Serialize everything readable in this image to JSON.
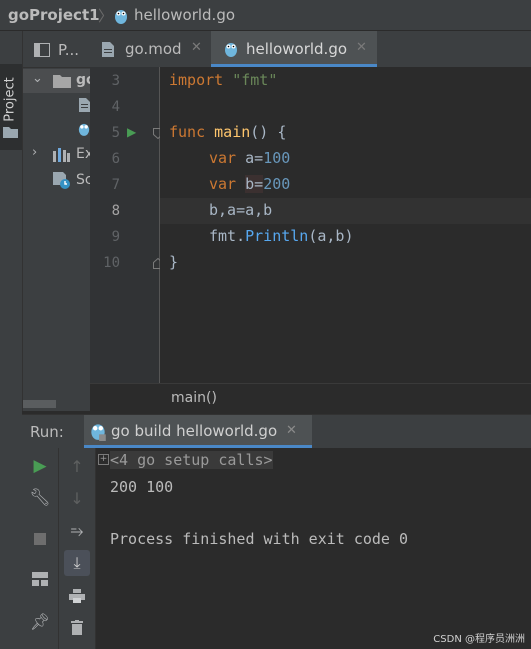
{
  "breadcrumb": {
    "project": "goProject1",
    "file": "helloworld.go"
  },
  "left_strip": {
    "project_tab": "Project"
  },
  "project_panel": {
    "header_label": "P...",
    "tree": [
      "go",
      "Ex",
      "Sc"
    ]
  },
  "tabs": [
    {
      "label": "go.mod",
      "active": false
    },
    {
      "label": "helloworld.go",
      "active": true
    }
  ],
  "editor": {
    "line_numbers": [
      "3",
      "4",
      "5",
      "6",
      "7",
      "8",
      "9",
      "10"
    ],
    "current_line": "8",
    "code": {
      "l3": {
        "kw": "import",
        "str": "\"fmt\""
      },
      "l5": {
        "kw": "func",
        "name": "main",
        "rest": "() {"
      },
      "l6": {
        "kw": "var",
        "var": "a=",
        "num": "100"
      },
      "l7": {
        "kw": "var",
        "var": "b=",
        "num": "200"
      },
      "l8": "b,a=a,b",
      "l9": {
        "pkg": "fmt.",
        "method": "Println",
        "rest": "(a,b)"
      },
      "l10": "}"
    },
    "crumb": "main()"
  },
  "run": {
    "label": "Run:",
    "tab": "go build helloworld.go",
    "output": {
      "setup_calls": "<4 go setup calls>",
      "result": "200 100",
      "finished": "Process finished with exit code 0"
    }
  },
  "watermark": "CSDN @程序员洲洲",
  "colors": {
    "keyword": "#cc7832",
    "string": "#6a8759",
    "number": "#6897bb",
    "function": "#ffc66d",
    "run_green": "#499c54",
    "accent": "#4a88c7"
  }
}
